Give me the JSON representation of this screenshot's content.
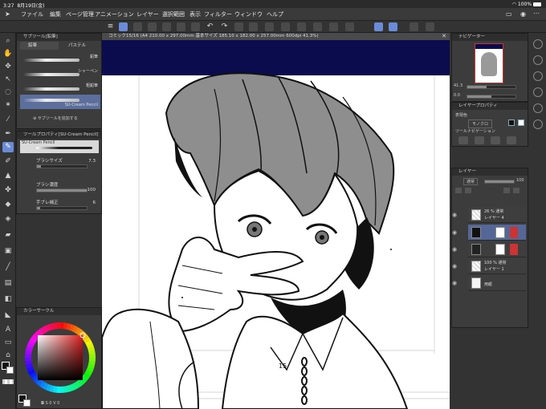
{
  "status_bar": {
    "time": "3:27",
    "date": "8月19日(金)",
    "battery": "100%"
  },
  "menu": [
    "ファイル",
    "編集",
    "ページ管理",
    "アニメーション",
    "レイヤー",
    "選択範囲",
    "表示",
    "フィルター",
    "ウィンドウ",
    "ヘルプ"
  ],
  "document_tab": "コミック15/16 (A4 210.00 x 297.00mm 基本サイズ 185.10 x 182.00 x 257.00mm 600dpi 41.3%)",
  "subtool": {
    "title": "サブツール[鉛筆]",
    "tabs": [
      "鉛筆",
      "パステル"
    ],
    "brushes": [
      "鉛筆",
      "シャーペン",
      "粗鉛筆",
      "SU-Cream Pencil"
    ],
    "footer": "サブツールを追加する"
  },
  "tool_property": {
    "title": "ツールプロパティ[SU-Cream Pencil]",
    "preset_label": "SU-Cream Pencil",
    "rows": [
      {
        "label": "ブラシサイズ",
        "value": "7.3",
        "fraction": 0.08
      },
      {
        "label": "ブラシ濃度",
        "value": "100",
        "fraction": 1.0
      },
      {
        "label": "手ブレ補正",
        "value": "6",
        "fraction": 0.06
      }
    ]
  },
  "color_panel": {
    "title": "カラーサークル",
    "selected_color": "#dc1e1e"
  },
  "canvas": {
    "page_number": "15",
    "top_band_color": "#0a0c4e"
  },
  "navigator": {
    "title": "ナビゲーター",
    "zoom": "41.3",
    "angle": "0.0"
  },
  "layer_property": {
    "title": "レイヤープロパティ",
    "expression_label": "表現色",
    "expression_value": "モノクロ",
    "tool_navigation": "ツールナビゲーション"
  },
  "layers": {
    "title": "レイヤー",
    "blend_mode": "通常",
    "opacity": "100",
    "items": [
      {
        "info": "26 % 通常",
        "name": "レイヤー 4",
        "selected": false
      },
      {
        "info": "",
        "name": "",
        "selected": true
      },
      {
        "info": "",
        "name": "",
        "selected": false
      },
      {
        "info": "100 % 通常",
        "name": "レイヤー 1",
        "selected": false
      },
      {
        "info": "",
        "name": "用紙",
        "selected": false
      }
    ]
  }
}
